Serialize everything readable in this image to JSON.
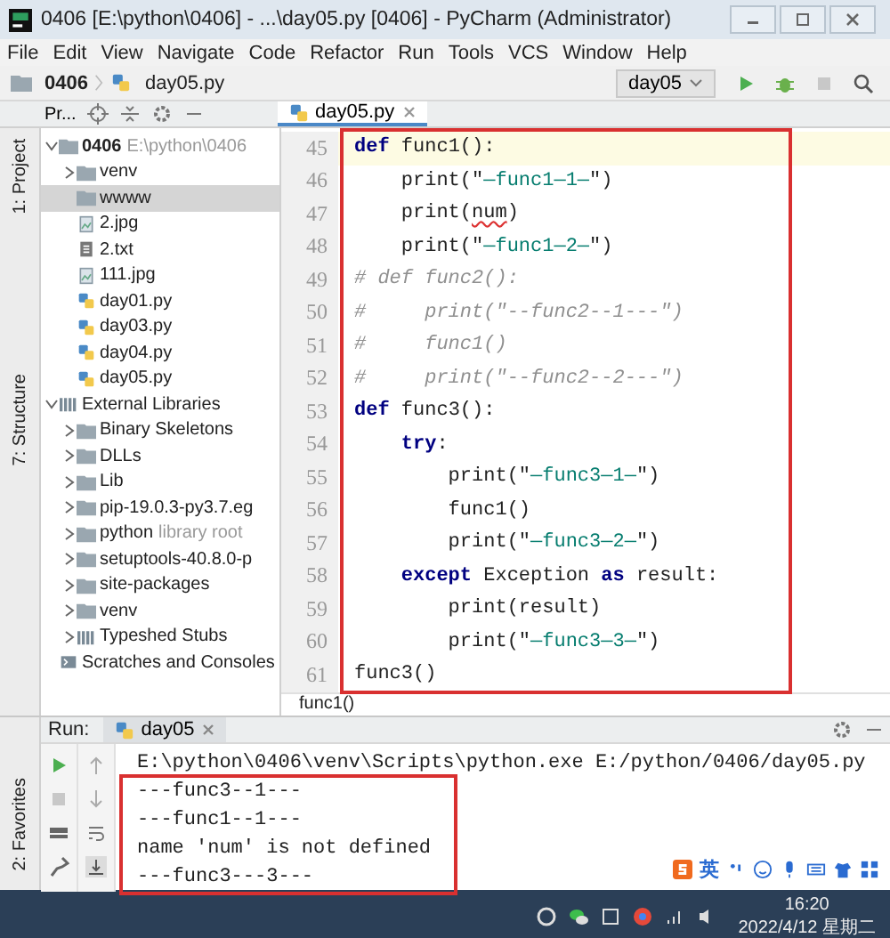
{
  "window": {
    "title": "0406 [E:\\python\\0406] - ...\\day05.py [0406] - PyCharm (Administrator)"
  },
  "menu": [
    "File",
    "Edit",
    "View",
    "Navigate",
    "Code",
    "Refactor",
    "Run",
    "Tools",
    "VCS",
    "Window",
    "Help"
  ],
  "navbar": {
    "breadcrumbs": [
      {
        "label": "0406",
        "kind": "folder"
      },
      {
        "label": "day05.py",
        "kind": "python"
      }
    ],
    "run_config": "day05"
  },
  "project_toolbar": {
    "label": "Pr..."
  },
  "editor_tabs": [
    {
      "label": "day05.py",
      "selected": true
    }
  ],
  "side_stripe": {
    "top": [
      "1: Project",
      "7: Structure"
    ],
    "bottom": [
      "2: Favorites"
    ]
  },
  "tree": [
    {
      "label": "0406",
      "hint": "E:\\python\\0406",
      "kind": "folder",
      "expanded": true,
      "selected": false,
      "children": [
        {
          "label": "venv",
          "kind": "folder",
          "expanded": false,
          "selected": false
        },
        {
          "label": "wwww",
          "kind": "folder",
          "selected": true
        },
        {
          "label": "2.jpg",
          "kind": "image",
          "selected": false
        },
        {
          "label": "2.txt",
          "kind": "text",
          "selected": false
        },
        {
          "label": "111.jpg",
          "kind": "image",
          "selected": false
        },
        {
          "label": "day01.py",
          "kind": "python",
          "selected": false
        },
        {
          "label": "day03.py",
          "kind": "python",
          "selected": false
        },
        {
          "label": "day04.py",
          "kind": "python",
          "selected": false
        },
        {
          "label": "day05.py",
          "kind": "python",
          "selected": false
        }
      ]
    },
    {
      "label": "External Libraries",
      "kind": "library",
      "expanded": true,
      "selected": false,
      "children": [
        {
          "label": "Binary Skeletons",
          "kind": "folder",
          "expanded": false,
          "selected": false
        },
        {
          "label": "DLLs",
          "kind": "folder",
          "expanded": false,
          "selected": false
        },
        {
          "label": "Lib",
          "kind": "folder",
          "expanded": false,
          "selected": false
        },
        {
          "label": "pip-19.0.3-py3.7.eg",
          "kind": "folder",
          "expanded": false,
          "selected": false
        },
        {
          "label": "python",
          "hint": "library root",
          "kind": "folder",
          "expanded": false,
          "selected": false
        },
        {
          "label": "setuptools-40.8.0-p",
          "kind": "folder",
          "expanded": false,
          "selected": false
        },
        {
          "label": "site-packages",
          "kind": "folder",
          "expanded": false,
          "selected": false
        },
        {
          "label": "venv",
          "kind": "folder",
          "expanded": false,
          "selected": false
        },
        {
          "label": "Typeshed Stubs",
          "kind": "library",
          "expanded": false,
          "selected": false
        }
      ]
    },
    {
      "label": "Scratches and Consoles",
      "kind": "scratch",
      "selected": false
    }
  ],
  "editor": {
    "lines": [
      {
        "number": "45",
        "current": true,
        "tokens": [
          {
            "kind": "kw",
            "text": "def"
          },
          {
            "kind": "plain",
            "text": " func1():"
          }
        ]
      },
      {
        "number": "46",
        "current": false,
        "tokens": [
          {
            "kind": "plain",
            "text": "    print(\""
          },
          {
            "kind": "str",
            "text": "—func1—1—"
          },
          {
            "kind": "plain",
            "text": "\")"
          }
        ]
      },
      {
        "number": "47",
        "current": false,
        "tokens": [
          {
            "kind": "plain",
            "text": "    print("
          },
          {
            "kind": "err",
            "text": "num"
          },
          {
            "kind": "plain",
            "text": ")"
          }
        ]
      },
      {
        "number": "48",
        "current": false,
        "tokens": [
          {
            "kind": "plain",
            "text": "    print(\""
          },
          {
            "kind": "str",
            "text": "—func1—2—"
          },
          {
            "kind": "plain",
            "text": "\")"
          }
        ]
      },
      {
        "number": "49",
        "current": false,
        "tokens": [
          {
            "kind": "comment",
            "text": "# def func2():"
          }
        ]
      },
      {
        "number": "50",
        "current": false,
        "tokens": [
          {
            "kind": "comment",
            "text": "#     print(\"--func2--1---\")"
          }
        ]
      },
      {
        "number": "51",
        "current": false,
        "tokens": [
          {
            "kind": "comment",
            "text": "#     func1()"
          }
        ]
      },
      {
        "number": "52",
        "current": false,
        "tokens": [
          {
            "kind": "comment",
            "text": "#     print(\"--func2--2---\")"
          }
        ]
      },
      {
        "number": "53",
        "current": false,
        "tokens": [
          {
            "kind": "kw",
            "text": "def"
          },
          {
            "kind": "plain",
            "text": " func3():"
          }
        ]
      },
      {
        "number": "54",
        "current": false,
        "tokens": [
          {
            "kind": "kw",
            "text": "    try"
          },
          {
            "kind": "plain",
            "text": ":"
          }
        ]
      },
      {
        "number": "55",
        "current": false,
        "tokens": [
          {
            "kind": "plain",
            "text": "        print(\""
          },
          {
            "kind": "str",
            "text": "—func3—1—"
          },
          {
            "kind": "plain",
            "text": "\")"
          }
        ]
      },
      {
        "number": "56",
        "current": false,
        "tokens": [
          {
            "kind": "plain",
            "text": "        func1()"
          }
        ]
      },
      {
        "number": "57",
        "current": false,
        "tokens": [
          {
            "kind": "plain",
            "text": "        print(\""
          },
          {
            "kind": "str",
            "text": "—func3—2—"
          },
          {
            "kind": "plain",
            "text": "\")"
          }
        ]
      },
      {
        "number": "58",
        "current": false,
        "tokens": [
          {
            "kind": "kw",
            "text": "    except"
          },
          {
            "kind": "plain",
            "text": " Exception "
          },
          {
            "kind": "kw",
            "text": "as"
          },
          {
            "kind": "plain",
            "text": " result:"
          }
        ]
      },
      {
        "number": "59",
        "current": false,
        "tokens": [
          {
            "kind": "plain",
            "text": "        print(result)"
          }
        ]
      },
      {
        "number": "60",
        "current": false,
        "tokens": [
          {
            "kind": "plain",
            "text": "        print(\""
          },
          {
            "kind": "str",
            "text": "—func3—3—"
          },
          {
            "kind": "plain",
            "text": "\")"
          }
        ]
      },
      {
        "number": "61",
        "current": false,
        "tokens": [
          {
            "kind": "plain",
            "text": "func3()"
          }
        ]
      }
    ],
    "breadcrumb": "func1()"
  },
  "run": {
    "label": "Run:",
    "tab": "day05",
    "output": [
      "E:\\python\\0406\\venv\\Scripts\\python.exe E:/python/0406/day05.py",
      "---func3--1---",
      "---func1--1---",
      "name 'num' is not defined",
      "---func3---3---"
    ]
  },
  "ime": {
    "label": "英"
  },
  "taskbar": {
    "time": "16:20",
    "date": "2022/4/12 星期二"
  }
}
